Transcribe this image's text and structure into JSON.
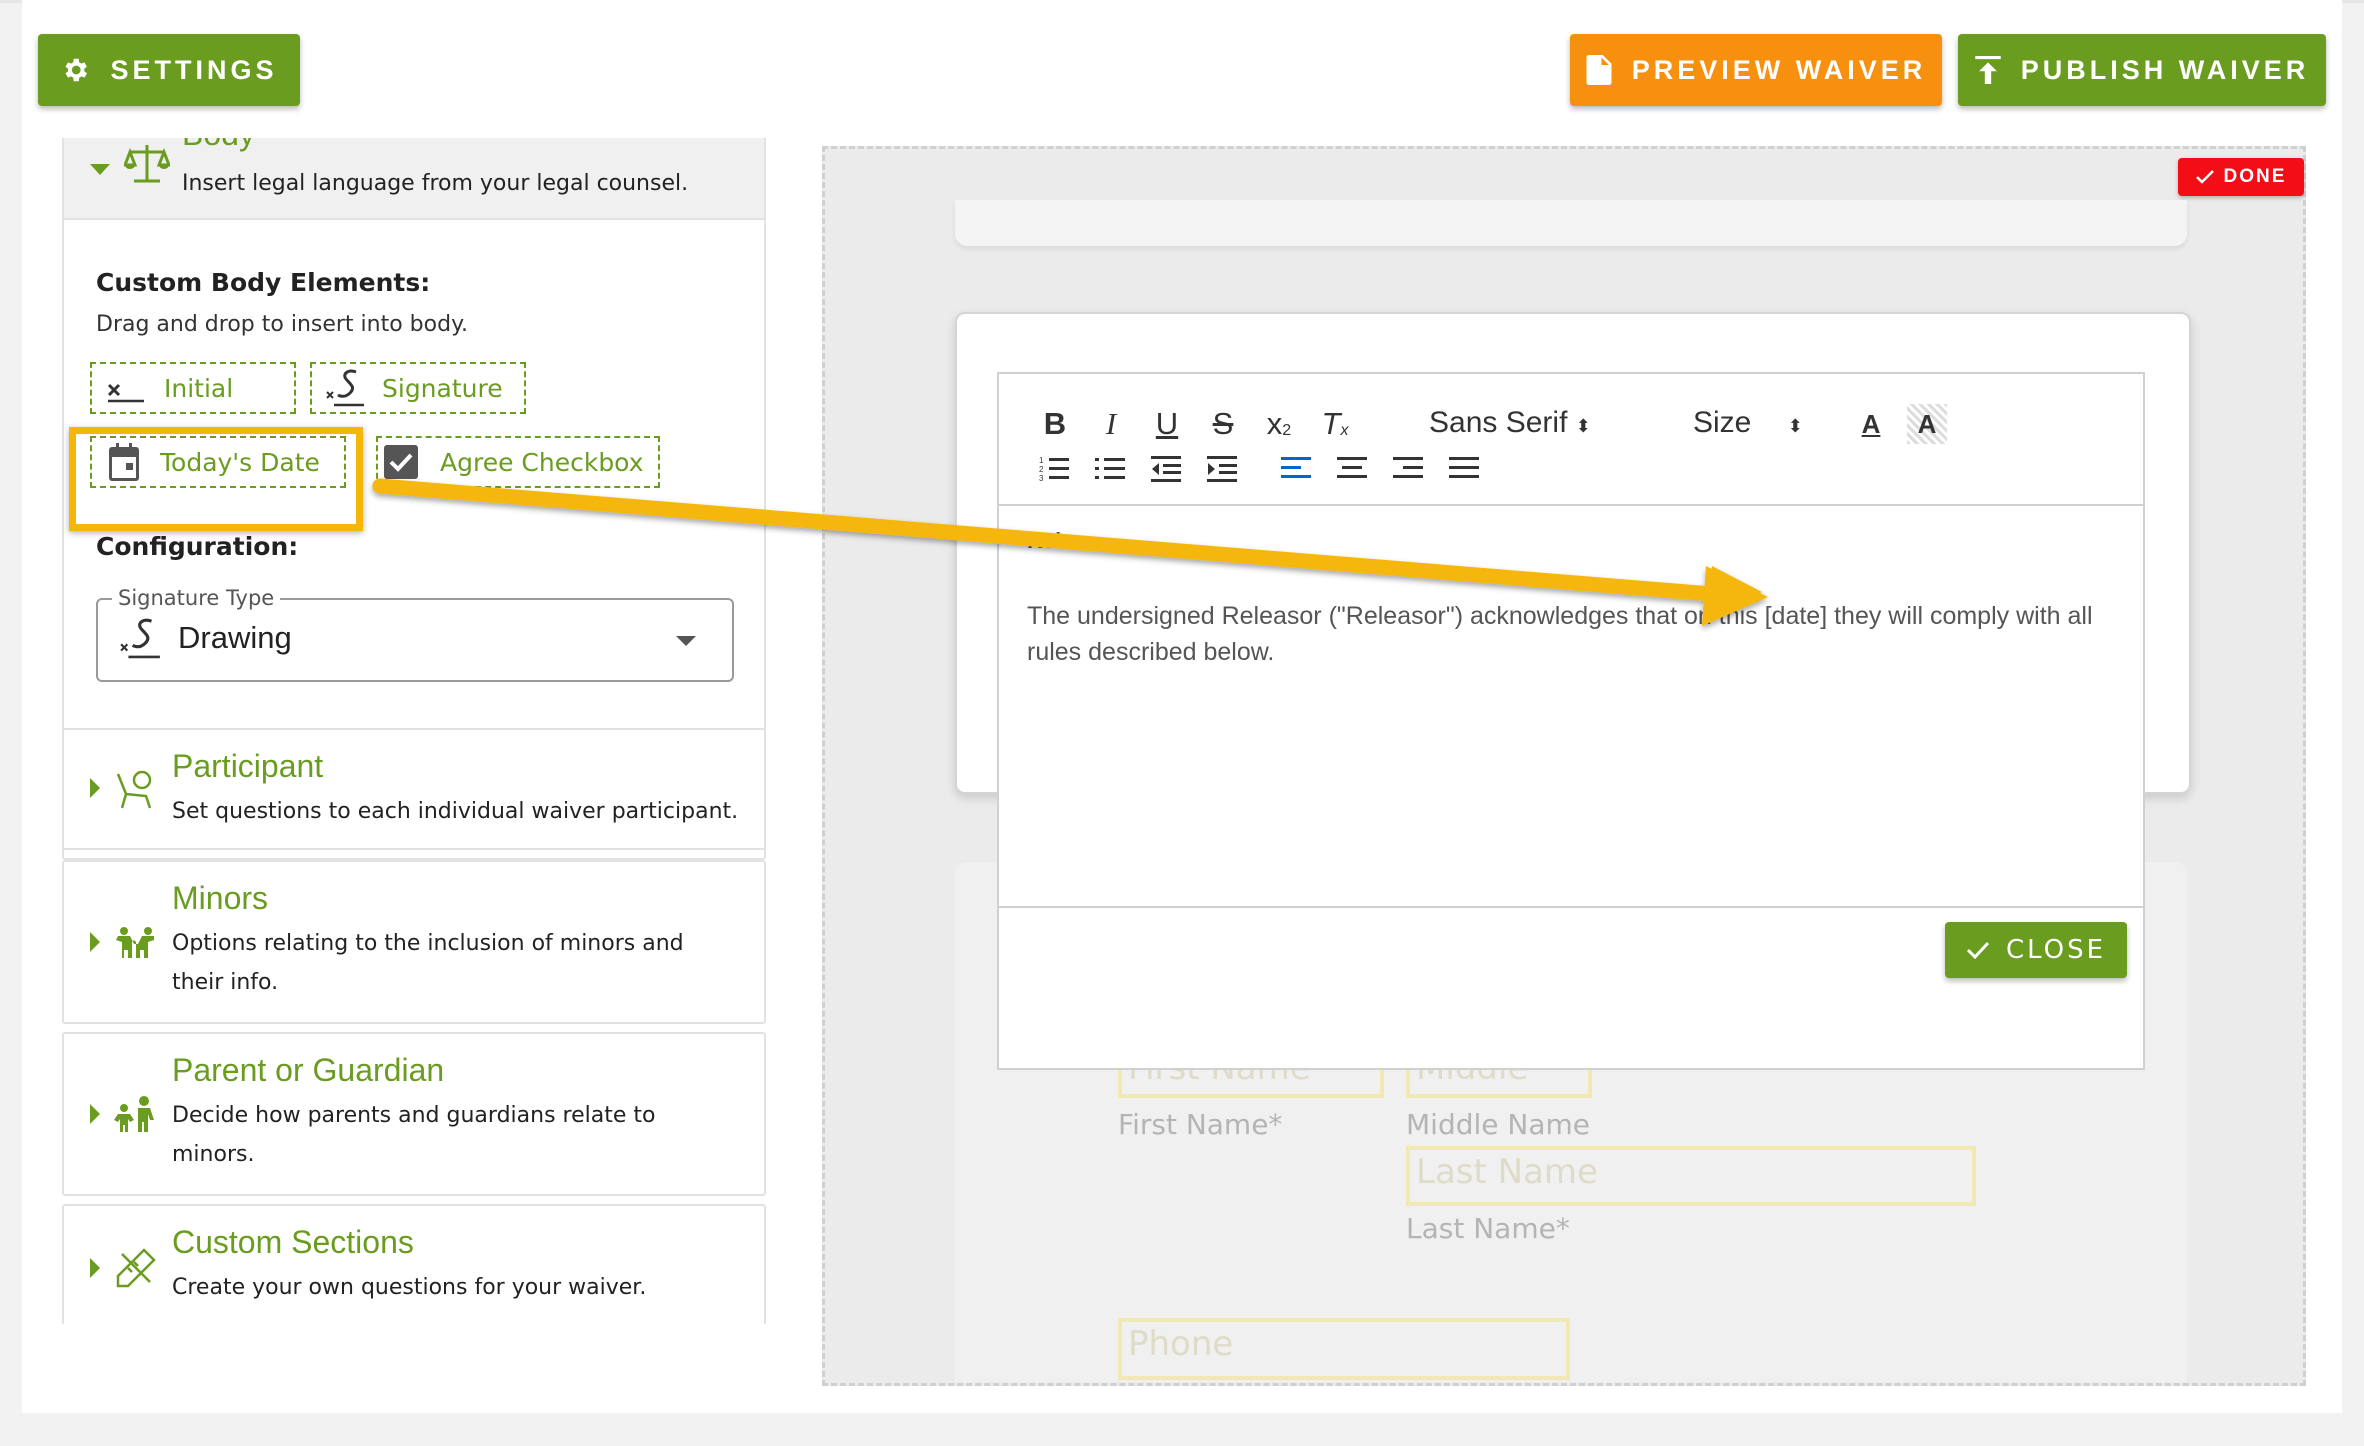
{
  "header": {
    "settings_label": "SETTINGS",
    "preview_label": "PREVIEW WAIVER",
    "publish_label": "PUBLISH WAIVER"
  },
  "sidebar": {
    "body": {
      "title": "Body",
      "description": "Insert legal language from your legal counsel.",
      "custom_elements_heading": "Custom Body Elements:",
      "custom_elements_hint": "Drag and drop to insert into body.",
      "chips": [
        {
          "label": "Initial",
          "icon": "initial-icon"
        },
        {
          "label": "Signature",
          "icon": "signature-icon"
        },
        {
          "label": "Today's Date",
          "icon": "calendar-icon"
        },
        {
          "label": "Agree Checkbox",
          "icon": "checkbox-icon"
        }
      ],
      "configuration_heading": "Configuration:",
      "signature_type": {
        "legend": "Signature Type",
        "value": "Drawing"
      }
    },
    "sections": [
      {
        "title": "Participant",
        "description": "Set questions to each individual waiver participant.",
        "icon": "participant-icon"
      },
      {
        "title": "Minors",
        "description": "Options relating to the inclusion of minors and their info.",
        "icon": "minors-icon"
      },
      {
        "title": "Parent or Guardian",
        "description": "Decide how parents and guardians relate to minors.",
        "icon": "guardian-icon"
      },
      {
        "title": "Custom Sections",
        "description": "Create your own questions for your waiver.",
        "icon": "custom-sections-icon"
      }
    ]
  },
  "preview": {
    "done_label": "DONE",
    "editor": {
      "font_select": "Sans Serif",
      "size_select": "Size",
      "partial_heading": "Rel",
      "body_text": "The undersigned Releasor (\"Releasor\") acknowledges that on this [date] they will comply with all rules described below.",
      "close_label": "CLOSE"
    },
    "form_ghost": {
      "first_name_placeholder": "First Name",
      "middle_placeholder": "Middle",
      "first_name_label": "First Name*",
      "middle_name_label": "Middle Name",
      "last_name_placeholder": "Last Name",
      "last_name_label": "Last Name*",
      "phone_placeholder": "Phone"
    }
  },
  "colors": {
    "brand_green": "#6a9c1f",
    "preview_orange": "#f7900e",
    "done_red": "#f20d17",
    "annotation_yellow": "#f5b60a"
  }
}
